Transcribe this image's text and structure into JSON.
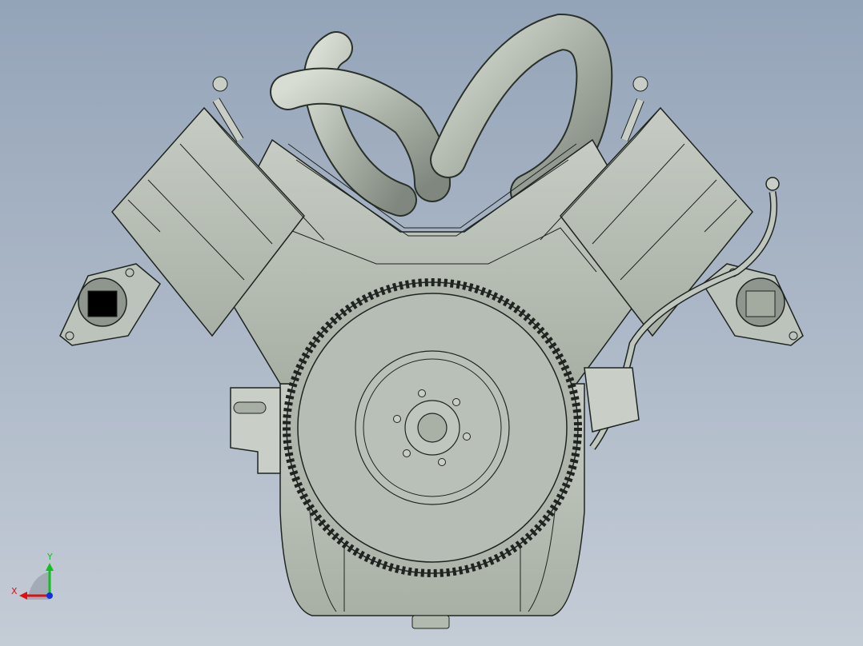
{
  "viewport": {
    "background_top": "#94a4b8",
    "background_bottom": "#c4ccd6",
    "model_fill": "#b9c1b7",
    "model_shade": "#9aa39a",
    "edge_color": "#1f2420"
  },
  "triad": {
    "x_label": "X",
    "y_label": "Y",
    "x_color": "#e01010",
    "y_color": "#10c020",
    "z_color": "#1030e0"
  }
}
